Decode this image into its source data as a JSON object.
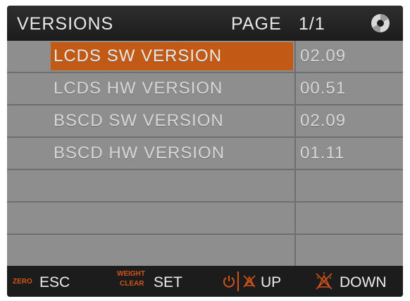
{
  "header": {
    "title": "VERSIONS",
    "page_label": "PAGE",
    "page_number": "1/1",
    "icon": "disc-icon"
  },
  "rows": [
    {
      "label": "LCDS SW VERSION",
      "value": "02.09",
      "selected": true
    },
    {
      "label": "LCDS HW VERSION",
      "value": "00.51",
      "selected": false
    },
    {
      "label": "BSCD SW VERSION",
      "value": "02.09",
      "selected": false
    },
    {
      "label": "BSCD HW VERSION",
      "value": "01.11",
      "selected": false
    },
    {
      "label": "",
      "value": "",
      "selected": false
    },
    {
      "label": "",
      "value": "",
      "selected": false
    },
    {
      "label": "",
      "value": "",
      "selected": false
    }
  ],
  "footer": {
    "esc": {
      "tag": "ZERO",
      "label": "ESC"
    },
    "set": {
      "tag_top": "WEIGHT",
      "tag_bottom": "CLEAR",
      "label": "SET"
    },
    "up": {
      "label": "UP",
      "icons": [
        "power-icon",
        "alarm-mute-icon"
      ]
    },
    "down": {
      "label": "DOWN",
      "icons": [
        "alarm-silence-icon"
      ]
    }
  },
  "colors": {
    "accent_selected": "#c25a16",
    "key_tag": "#d2531a",
    "table_background": "#8e8e8e",
    "screen_background": "#1c1c1c"
  }
}
